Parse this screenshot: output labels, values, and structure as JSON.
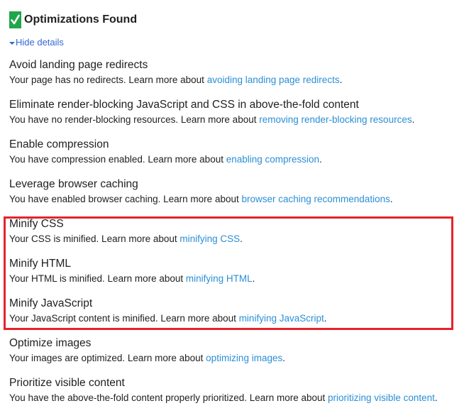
{
  "header": {
    "title": "Optimizations Found",
    "check_color": "#1fa64a"
  },
  "toggle": {
    "label": "Hide details",
    "icon": "caret-down-icon"
  },
  "rules": [
    {
      "title": "Avoid landing page redirects",
      "desc_prefix": "Your page has no redirects. Learn more about ",
      "link": "avoiding landing page redirects",
      "suffix": "."
    },
    {
      "title": "Eliminate render-blocking JavaScript and CSS in above-the-fold content",
      "desc_prefix": "You have no render-blocking resources. Learn more about ",
      "link": "removing render-blocking resources",
      "suffix": "."
    },
    {
      "title": "Enable compression",
      "desc_prefix": "You have compression enabled. Learn more about ",
      "link": "enabling compression",
      "suffix": "."
    },
    {
      "title": "Leverage browser caching",
      "desc_prefix": "You have enabled browser caching. Learn more about ",
      "link": "browser caching recommendations",
      "suffix": "."
    },
    {
      "title": "Minify CSS",
      "desc_prefix": "Your CSS is minified. Learn more about ",
      "link": "minifying CSS",
      "suffix": "."
    },
    {
      "title": "Minify HTML",
      "desc_prefix": "Your HTML is minified. Learn more about ",
      "link": "minifying HTML",
      "suffix": "."
    },
    {
      "title": "Minify JavaScript",
      "desc_prefix": "Your JavaScript content is minified. Learn more about ",
      "link": "minifying JavaScript",
      "suffix": "."
    },
    {
      "title": "Optimize images",
      "desc_prefix": "Your images are optimized. Learn more about ",
      "link": "optimizing images",
      "suffix": "."
    },
    {
      "title": "Prioritize visible content",
      "desc_prefix": "You have the above-the-fold content properly prioritized. Learn more about ",
      "link": "prioritizing visible content",
      "suffix": "."
    }
  ],
  "colors": {
    "link": "#2b8fd6",
    "toggle": "#3367d6",
    "highlight_border": "#e6232b"
  }
}
